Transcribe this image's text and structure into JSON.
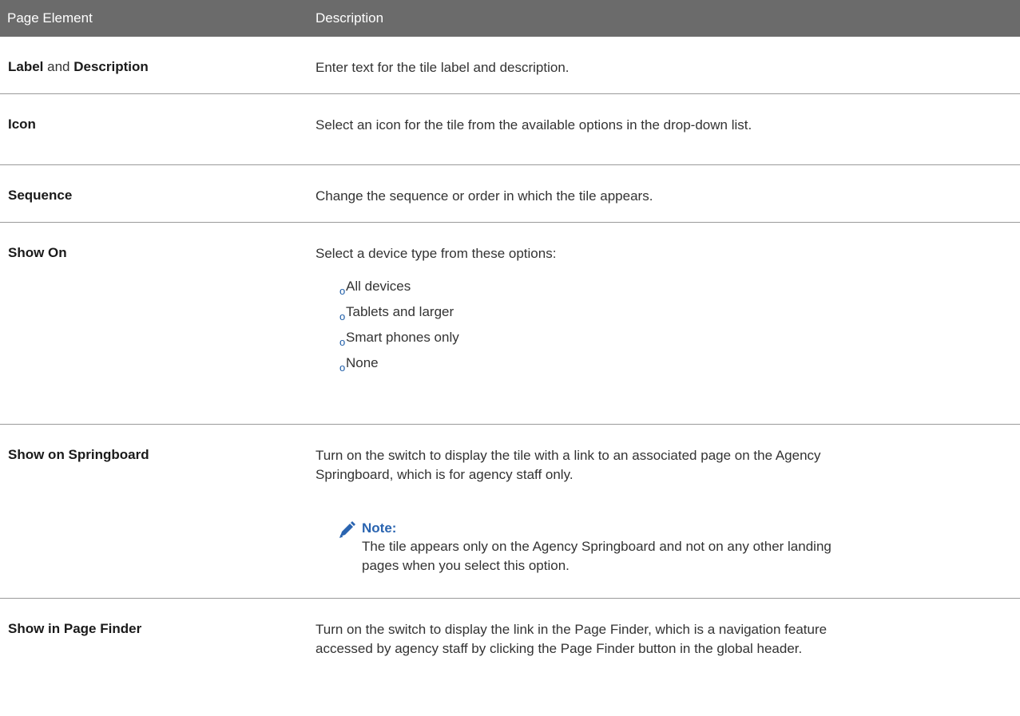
{
  "header": {
    "col_element": "Page Element",
    "col_description": "Description"
  },
  "rows": [
    {
      "element_parts": [
        "Label",
        " and ",
        "Description"
      ],
      "description": "Enter text for the tile label and description."
    },
    {
      "element_parts": [
        "Icon"
      ],
      "description": "Select an icon for the tile from the available options in the drop-down list."
    },
    {
      "element_parts": [
        "Sequence"
      ],
      "description": "Change the sequence or order in which the tile appears."
    },
    {
      "element_parts": [
        "Show On"
      ],
      "description": "Select a device type from these options:",
      "bullet_mark": "o",
      "options": [
        "All devices",
        "Tablets and larger",
        "Smart phones only",
        "None"
      ]
    },
    {
      "element_parts": [
        "Show on Springboard"
      ],
      "description_line1": "Turn on the switch to display the tile with a link to an associated page on the Agency",
      "description_line2": "Springboard, which is for agency staff only.",
      "note": {
        "icon": "pencil-icon",
        "title": "Note:",
        "line1": "The tile appears only on the Agency Springboard and not on any other landing",
        "line2": "pages when you select this option."
      }
    },
    {
      "element_parts": [
        "Show in Page Finder"
      ],
      "description_line1": "Turn on the switch to display the link in the Page Finder, which is a navigation feature",
      "description_line2": "accessed by agency staff by clicking the Page Finder button in the global header."
    }
  ],
  "colors": {
    "header_bg": "#6b6b6b",
    "header_text": "#ffffff",
    "note_accent": "#2a64b0",
    "bullet": "#1a5aa6"
  }
}
